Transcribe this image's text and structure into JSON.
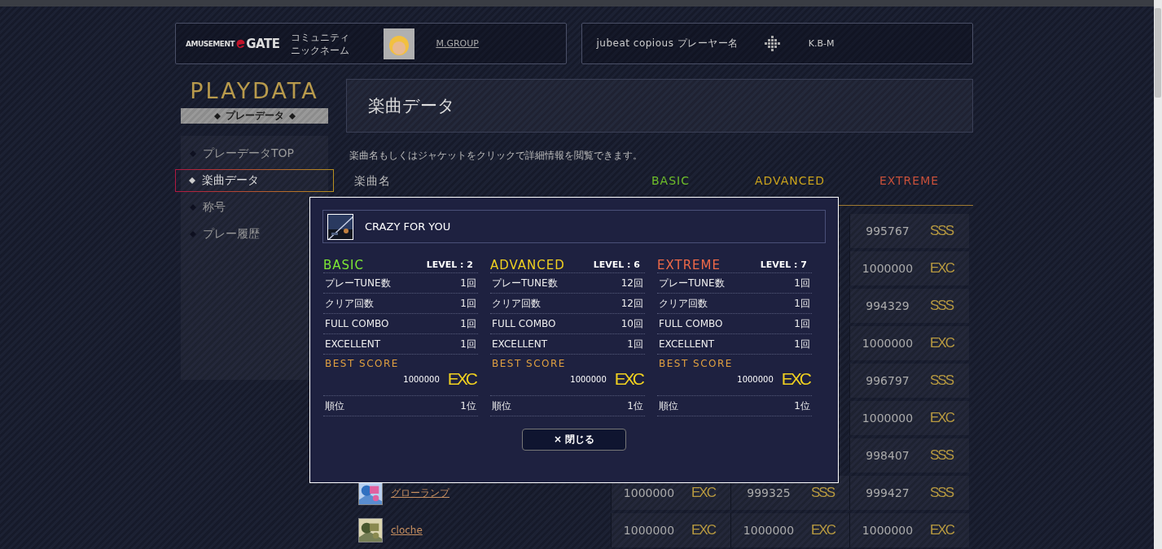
{
  "header": {
    "logo": {
      "small": "AMUSEMENT",
      "large": "GATE"
    },
    "community_label": [
      "コミュニティ",
      "ニックネーム"
    ],
    "nickname": "M.GROUP",
    "game_label": "jubeat copious プレーヤー名",
    "player_name": "K.B-M"
  },
  "sidebar": {
    "title": "PLAYDATA",
    "subtitle": "プレーデータ",
    "items": [
      {
        "label": "プレーデータTOP",
        "selected": false
      },
      {
        "label": "楽曲データ",
        "selected": true
      },
      {
        "label": "称号",
        "selected": false
      },
      {
        "label": "プレー履歴",
        "selected": false
      }
    ]
  },
  "main": {
    "heading": "楽曲データ",
    "description": "楽曲名もしくはジャケットをクリックで詳細情報を閲覧できます。",
    "table": {
      "columns": [
        {
          "label": "楽曲名",
          "color": "#bbbbbb"
        },
        {
          "label": "BASIC",
          "color": "#6fbf2a"
        },
        {
          "label": "ADVANCED",
          "color": "#c9a21c"
        },
        {
          "label": "EXTREME",
          "color": "#c8503a"
        }
      ],
      "rows": [
        {
          "extreme": {
            "score": "995767",
            "rank": "SSS"
          }
        },
        {
          "extreme": {
            "score": "1000000",
            "rank": "EXC"
          }
        },
        {
          "extreme": {
            "score": "994329",
            "rank": "SSS"
          }
        },
        {
          "extreme": {
            "score": "1000000",
            "rank": "EXC"
          }
        },
        {
          "extreme": {
            "score": "996797",
            "rank": "SSS"
          }
        },
        {
          "extreme": {
            "score": "1000000",
            "rank": "EXC"
          }
        },
        {
          "extreme": {
            "score": "998407",
            "rank": "SSS"
          }
        },
        {
          "title": "グローランプ",
          "basic": {
            "score": "1000000",
            "rank": "EXC"
          },
          "advanced": {
            "score": "999325",
            "rank": "SSS"
          },
          "extreme": {
            "score": "999427",
            "rank": "SSS"
          }
        },
        {
          "title": "cloche",
          "basic": {
            "score": "1000000",
            "rank": "EXC"
          },
          "advanced": {
            "score": "1000000",
            "rank": "EXC"
          },
          "extreme": {
            "score": "1000000",
            "rank": "EXC"
          }
        }
      ]
    }
  },
  "dialog": {
    "song_title": "CRAZY FOR YOU",
    "difficulties": [
      {
        "name": "BASIC",
        "color": "#7de834",
        "level": "LEVEL : 2",
        "stats": [
          {
            "label": "プレーTUNE数",
            "value": "1回"
          },
          {
            "label": "クリア回数",
            "value": "1回"
          },
          {
            "label": "FULL COMBO",
            "value": "1回"
          },
          {
            "label": "EXCELLENT",
            "value": "1回"
          }
        ],
        "best_score_label": "BEST SCORE",
        "best_score": "1000000",
        "rank": "EXC",
        "position_label": "順位",
        "position": "1位"
      },
      {
        "name": "ADVANCED",
        "color": "#f0d020",
        "level": "LEVEL : 6",
        "stats": [
          {
            "label": "プレーTUNE数",
            "value": "12回"
          },
          {
            "label": "クリア回数",
            "value": "12回"
          },
          {
            "label": "FULL COMBO",
            "value": "10回"
          },
          {
            "label": "EXCELLENT",
            "value": "1回"
          }
        ],
        "best_score_label": "BEST SCORE",
        "best_score": "1000000",
        "rank": "EXC",
        "position_label": "順位",
        "position": "1位"
      },
      {
        "name": "EXTREME",
        "color": "#f06a48",
        "level": "LEVEL : 7",
        "stats": [
          {
            "label": "プレーTUNE数",
            "value": "1回"
          },
          {
            "label": "クリア回数",
            "value": "1回"
          },
          {
            "label": "FULL COMBO",
            "value": "1回"
          },
          {
            "label": "EXCELLENT",
            "value": "1回"
          }
        ],
        "best_score_label": "BEST SCORE",
        "best_score": "1000000",
        "rank": "EXC",
        "position_label": "順位",
        "position": "1位"
      }
    ],
    "close_button": "× 閉じる"
  }
}
